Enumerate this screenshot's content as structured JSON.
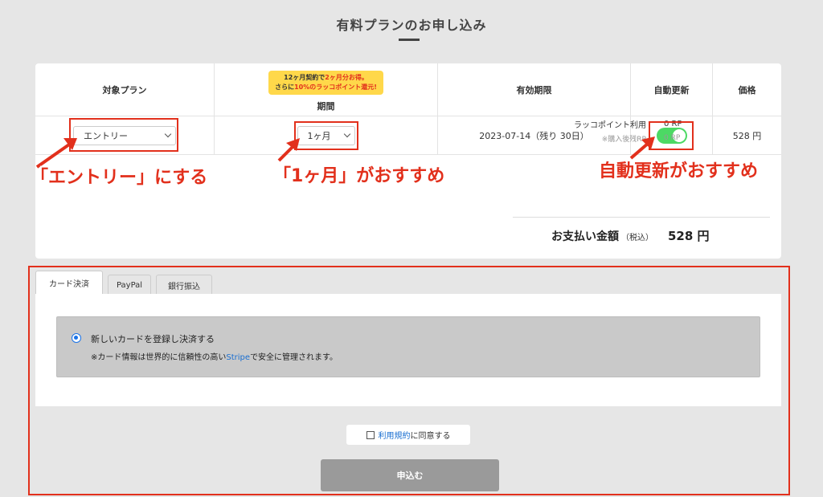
{
  "page": {
    "title": "有料プランのお申し込み"
  },
  "table": {
    "headers": {
      "plan": "対象プラン",
      "promo_line1_a": "12ヶ月契約で",
      "promo_line1_b": "2ヶ月分お得。",
      "promo_line2_a": "さらに",
      "promo_line2_b": "10%のラッコポイント還元!",
      "period": "期間",
      "expiry": "有効期限",
      "auto_renew": "自動更新",
      "price": "価格"
    },
    "row": {
      "plan_value": "エントリー",
      "period_value": "1ヶ月",
      "expiry_value": "2023-07-14（残り 30日）",
      "auto_renew_on": true,
      "price_value": "528 円"
    }
  },
  "points": {
    "use_label": "ラッコポイント利用",
    "use_value": "0 RP",
    "after_label": "※購入後残RP",
    "after_value": "0 RP"
  },
  "total": {
    "label": "お支払い金額",
    "tax": "（税込）",
    "value": "528 円"
  },
  "tabs": [
    "カード決済",
    "PayPal",
    "銀行振込"
  ],
  "card_option": {
    "title": "新しいカードを登録し決済する",
    "note_before": "※カード情報は世界的に信頼性の高い",
    "note_link": "Stripe",
    "note_after": "で安全に管理されます。"
  },
  "agree": {
    "link": "利用規約",
    "text": "に同意する"
  },
  "submit_label": "申込む",
  "annotations": {
    "plan": "「エントリー」にする",
    "period": "「1ヶ月」がおすすめ",
    "auto": "自動更新がおすすめ"
  },
  "colors": {
    "annotation": "#e2301c",
    "toggle": "#4cd964",
    "promo": "#ffd84a",
    "link": "#1a6fd1"
  }
}
